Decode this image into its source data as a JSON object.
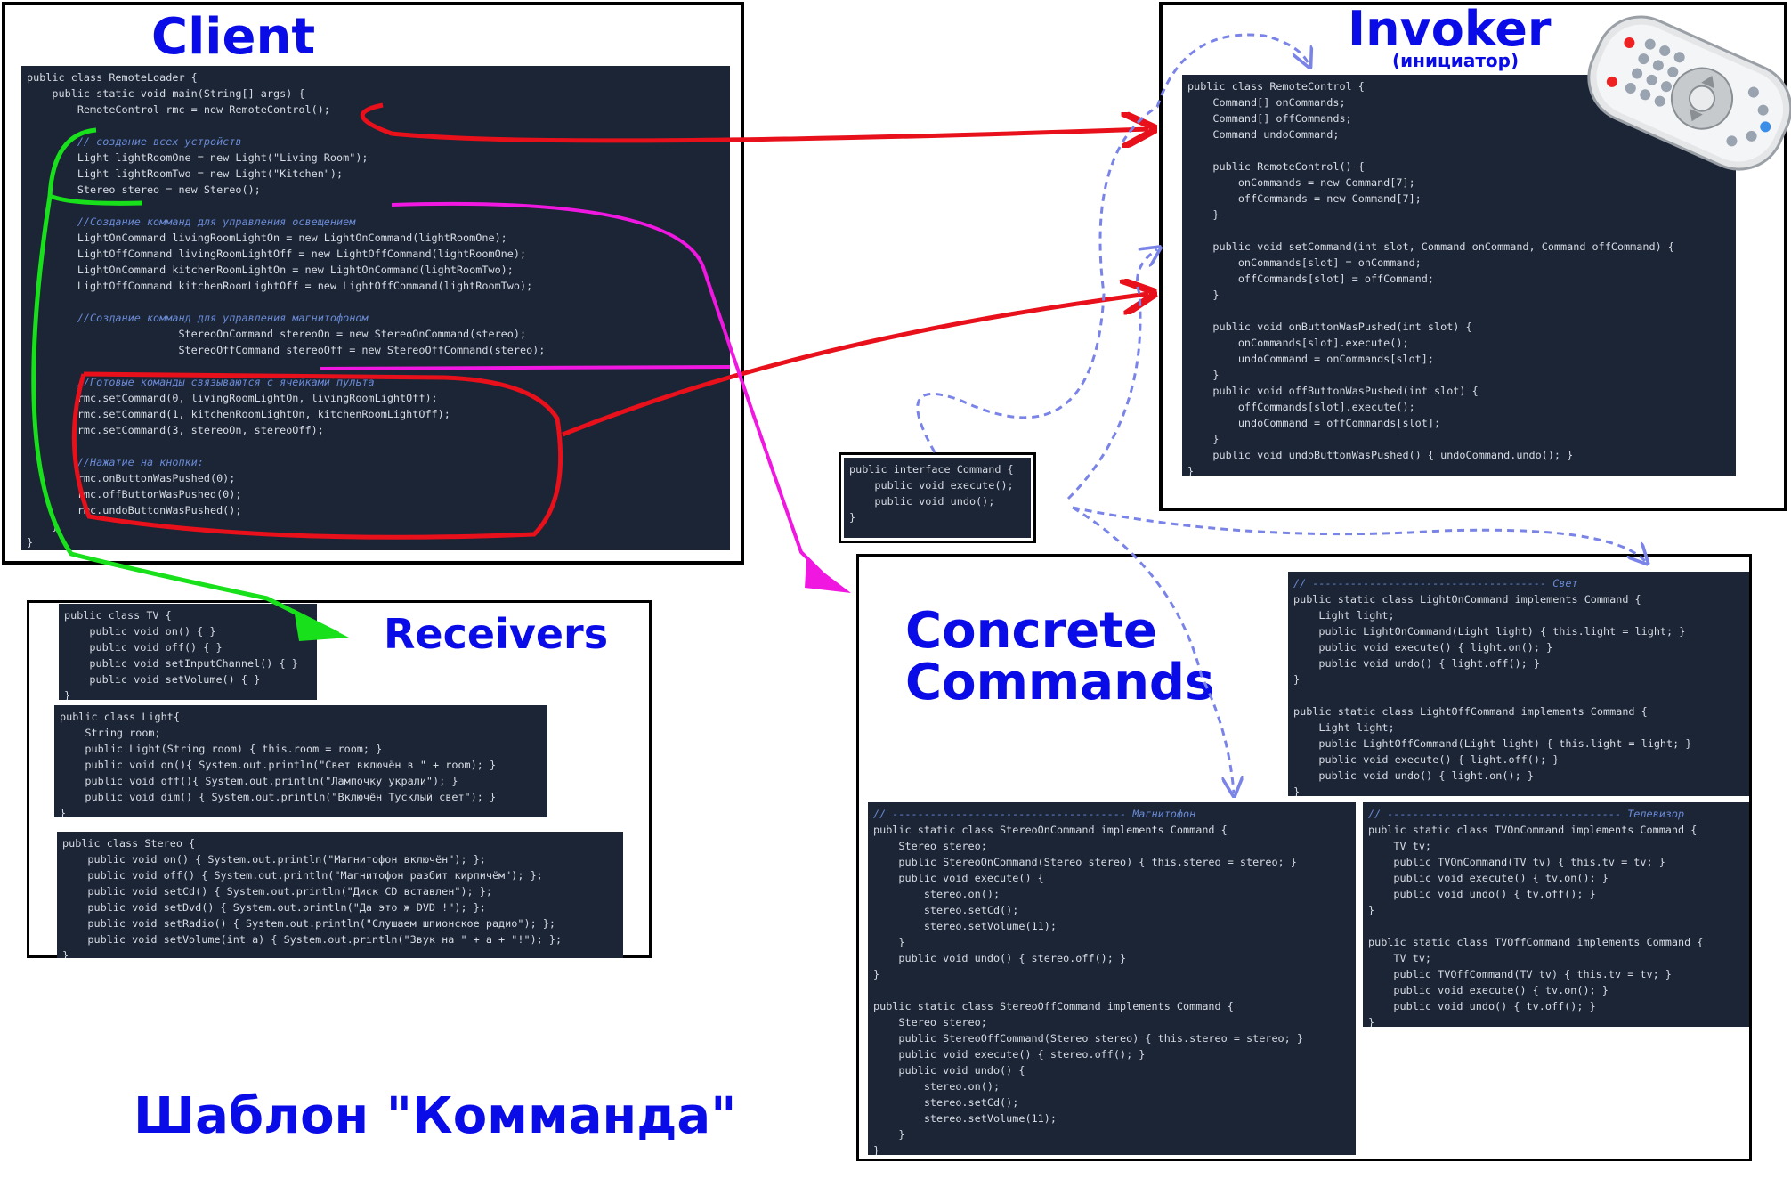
{
  "titles": {
    "client": "Client",
    "invoker": "Invoker",
    "invoker_sub": "(инициатор)",
    "receivers": "Receivers",
    "concrete_commands_line1": "Concrete",
    "concrete_commands_line2": "Commands",
    "pattern": "Шаблон \"Комманда\""
  },
  "colors": {
    "title_blue": "#0a0ce8",
    "code_bg": "#1b2536",
    "keyword": "#d98a2b",
    "string": "#e6c75a",
    "comment": "#6a8ad6",
    "arrow_red": "#e8101a",
    "arrow_green": "#18e01a",
    "arrow_magenta": "#f018e0",
    "arrow_dashed_blue": "#7a84e8"
  },
  "code": {
    "client": [
      "public class RemoteLoader {",
      "    public static void main(String[] args) {",
      "        RemoteControl rmc = new RemoteControl();",
      "",
      "        // создание всех устройств",
      "        Light lightRoomOne = new Light(\"Living Room\");",
      "        Light lightRoomTwo = new Light(\"Kitchen\");",
      "        Stereo stereo = new Stereo();",
      "",
      "        //Создание комманд для управления освещением",
      "        LightOnCommand livingRoomLightOn = new LightOnCommand(lightRoomOne);",
      "        LightOffCommand livingRoomLightOff = new LightOffCommand(lightRoomOne);",
      "        LightOnCommand kitchenRoomLightOn = new LightOnCommand(lightRoomTwo);",
      "        LightOffCommand kitchenRoomLightOff = new LightOffCommand(lightRoomTwo);",
      "",
      "        //Создание комманд для управления магнитофоном",
      "                        StereoOnCommand stereoOn = new StereoOnCommand(stereo);",
      "                        StereoOffCommand stereoOff = new StereoOffCommand(stereo);",
      "",
      "        //Готовые команды связываются с ячейками пульта",
      "        rmc.setCommand(0, livingRoomLightOn, livingRoomLightOff);",
      "        rmc.setCommand(1, kitchenRoomLightOn, kitchenRoomLightOff);",
      "        rmc.setCommand(3, stereoOn, stereoOff);",
      "",
      "        //Нажатие на кнопки:",
      "        rmc.onButtonWasPushed(0);",
      "        rmc.offButtonWasPushed(0);",
      "        rmc.undoButtonWasPushed();",
      "    }",
      "}"
    ],
    "invoker": [
      "public class RemoteControl {",
      "    Command[] onCommands;",
      "    Command[] offCommands;",
      "    Command undoCommand;",
      "",
      "    public RemoteControl() {",
      "        onCommands = new Command[7];",
      "        offCommands = new Command[7];",
      "    }",
      "",
      "    public void setCommand(int slot, Command onCommand, Command offCommand) {",
      "        onCommands[slot] = onCommand;",
      "        offCommands[slot] = offCommand;",
      "    }",
      "",
      "    public void onButtonWasPushed(int slot) {",
      "        onCommands[slot].execute();",
      "        undoCommand = onCommands[slot];",
      "    }",
      "    public void offButtonWasPushed(int slot) {",
      "        offCommands[slot].execute();",
      "        undoCommand = offCommands[slot];",
      "    }",
      "    public void undoButtonWasPushed() { undoCommand.undo(); }",
      "}"
    ],
    "command_interface": [
      "public interface Command {",
      "    public void execute();",
      "    public void undo();",
      "}"
    ],
    "tv": [
      "public class TV {",
      "    public void on() { }",
      "    public void off() { }",
      "    public void setInputChannel() { }",
      "    public void setVolume() { }",
      "}"
    ],
    "light": [
      "public class Light{",
      "    String room;",
      "    public Light(String room) { this.room = room; }",
      "    public void on(){ System.out.println(\"Свет включён в \" + room); }",
      "    public void off(){ System.out.println(\"Лампочку украли\"); }",
      "    public void dim() { System.out.println(\"Включён Тусклый свет\"); }",
      "}"
    ],
    "stereo": [
      "public class Stereo {",
      "    public void on() { System.out.println(\"Магнитофон включён\"); };",
      "    public void off() { System.out.println(\"Магнитофон разбит кирпичём\"); };",
      "    public void setCd() { System.out.println(\"Диск CD вставлен\"); };",
      "    public void setDvd() { System.out.println(\"Да это ж DVD !\"); };",
      "    public void setRadio() { System.out.println(\"Слушаем шпионское радио\"); };",
      "    public void setVolume(int a) { System.out.println(\"Звук на \" + a + \"!\"); };",
      "}"
    ],
    "light_commands": [
      "// ------------------------------------- Свет",
      "public static class LightOnCommand implements Command {",
      "    Light light;",
      "    public LightOnCommand(Light light) { this.light = light; }",
      "    public void execute() { light.on(); }",
      "    public void undo() { light.off(); }",
      "}",
      "",
      "public static class LightOffCommand implements Command {",
      "    Light light;",
      "    public LightOffCommand(Light light) { this.light = light; }",
      "    public void execute() { light.off(); }",
      "    public void undo() { light.on(); }",
      "}"
    ],
    "stereo_commands": [
      "// ------------------------------------- Магнитофон",
      "public static class StereoOnCommand implements Command {",
      "    Stereo stereo;",
      "    public StereoOnCommand(Stereo stereo) { this.stereo = stereo; }",
      "    public void execute() {",
      "        stereo.on();",
      "        stereo.setCd();",
      "        stereo.setVolume(11);",
      "    }",
      "    public void undo() { stereo.off(); }",
      "}",
      "",
      "public static class StereoOffCommand implements Command {",
      "    Stereo stereo;",
      "    public StereoOffCommand(Stereo stereo) { this.stereo = stereo; }",
      "    public void execute() { stereo.off(); }",
      "    public void undo() {",
      "        stereo.on();",
      "        stereo.setCd();",
      "        stereo.setVolume(11);",
      "    }",
      "}"
    ],
    "tv_commands": [
      "// ------------------------------------- Телевизор",
      "public static class TVOnCommand implements Command {",
      "    TV tv;",
      "    public TVOnCommand(TV tv) { this.tv = tv; }",
      "    public void execute() { tv.on(); }",
      "    public void undo() { tv.off(); }",
      "}",
      "",
      "public static class TVOffCommand implements Command {",
      "    TV tv;",
      "    public TVOffCommand(TV tv) { this.tv = tv; }",
      "    public void execute() { tv.on(); }",
      "    public void undo() { tv.off(); }",
      "}"
    ]
  },
  "icons": {
    "remote": "remote-control-icon"
  }
}
